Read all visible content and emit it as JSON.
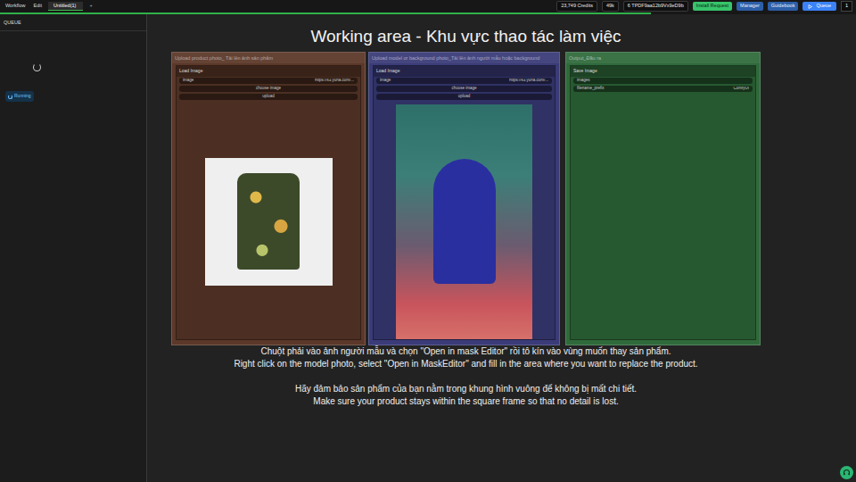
{
  "app_menu": [
    {
      "label": "Workflow"
    },
    {
      "label": "Edit"
    }
  ],
  "tabs": [
    {
      "label": "Untitled(1)",
      "selected": true
    }
  ],
  "new_tab_icon": "+",
  "run_progress": {
    "level": 0.76
  },
  "toolbar": [
    {
      "label": "23,749 Credits",
      "kind": "pill"
    },
    {
      "label": "49k",
      "kind": "pill"
    },
    {
      "label": "6 TPDF9aa12b9Vx9eD9b",
      "kind": "pill"
    },
    {
      "label": "Install Request",
      "kind": "green"
    },
    {
      "label": "Manager",
      "kind": "blue"
    },
    {
      "label": "Guidebook",
      "kind": "blue"
    }
  ],
  "queue_button": {
    "label": "Queue",
    "count": "1"
  },
  "sidebar": {
    "title": "QUEUE",
    "task_status": "Running"
  },
  "canvas": {
    "title": "Working area - Khu vực thao tác làm việc",
    "groups": [
      {
        "title": "Upload product photo_ Tải lên ảnh sản phẩm",
        "color": "#5b3829",
        "node": {
          "title": "Load Image",
          "fields": [
            {
              "label": "image",
              "value": "https://s3.yuna.com/...",
              "kind": "combo"
            },
            {
              "label": "choose image",
              "kind": "button"
            },
            {
              "label": "upload",
              "kind": "button"
            }
          ]
        },
        "picture_kind": "product"
      },
      {
        "title": "Upload model or background photo_Tải lên ảnh người mẫu hoặc background",
        "color": "#3a3b78",
        "node": {
          "title": "Load Image",
          "fields": [
            {
              "label": "image",
              "value": "https://s3.yuna.com/...",
              "kind": "combo"
            },
            {
              "label": "choose image",
              "kind": "button"
            },
            {
              "label": "upload",
              "kind": "button"
            }
          ]
        },
        "picture_kind": "model"
      },
      {
        "title": "Output_Đầu ra",
        "color": "#2f6a3b",
        "node": {
          "title": "Save Image",
          "fields": [
            {
              "label": "images",
              "value": "",
              "kind": "input"
            },
            {
              "label": "filename_prefix",
              "value": "ComfyUI",
              "kind": "combo"
            }
          ]
        },
        "picture_kind": "none"
      }
    ],
    "instructions": [
      "Chuột phải vào ảnh người mẫu và chọn \"Open in mask Editor\" rồi tô kín vào vùng muốn thay sản phẩm.",
      "Right click on the model photo, select \"Open in MaskEditor\" and fill in the area where you want to replace the product.",
      "Hãy đảm bảo sản phẩm của bạn nằm trong khung hình vuông để không bị mất chi tiết.",
      "Make sure your product stays within the square frame so that no detail is lost."
    ]
  }
}
